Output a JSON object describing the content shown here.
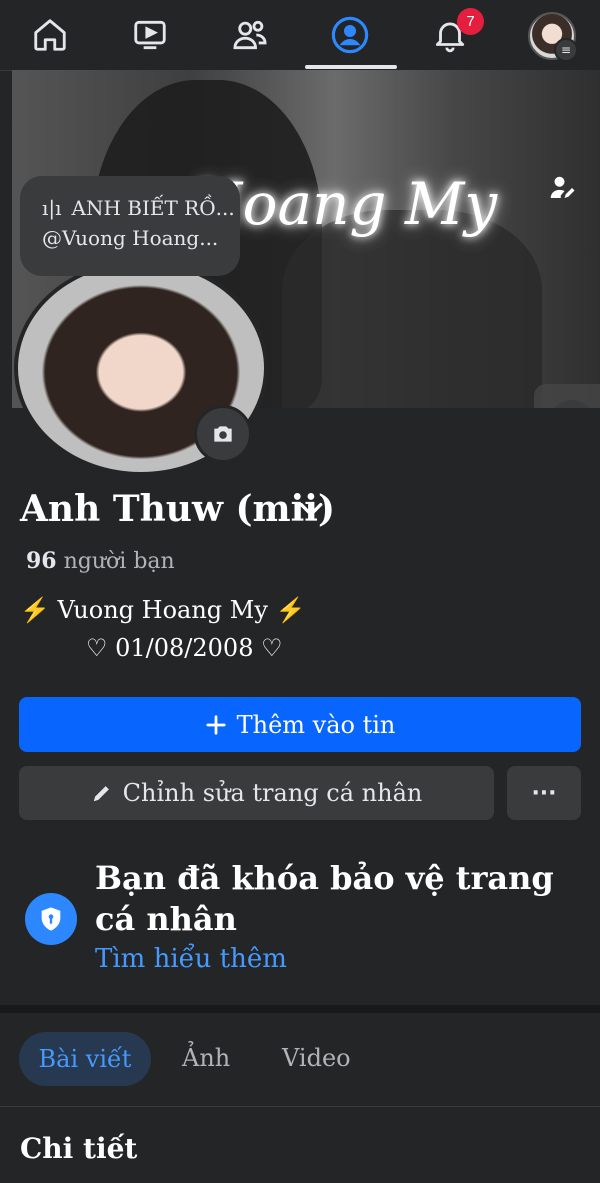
{
  "nav": {
    "items": [
      {
        "name": "home"
      },
      {
        "name": "video"
      },
      {
        "name": "friends"
      },
      {
        "name": "profile",
        "active": true
      },
      {
        "name": "notifications"
      },
      {
        "name": "menu-avatar"
      }
    ],
    "notification_badge": "7"
  },
  "cover": {
    "title_text": "Hoang My"
  },
  "note": {
    "line1": "ANH BIẾT RỒ...",
    "line2": "@Vuong Hoang..."
  },
  "profile": {
    "name": "Anh Thuw (mii)",
    "friends_count": "96",
    "friends_label": "người bạn",
    "bio_line1": "⚡ Vuong Hoang My ⚡",
    "bio_line2": "♡ 01/08/2008 ♡"
  },
  "actions": {
    "add_story_label": "Thêm vào tin",
    "edit_profile_label": "Chỉnh sửa trang cá nhân",
    "more_label": "···"
  },
  "lock_notice": {
    "title": "Bạn đã khóa bảo vệ trang cá nhân",
    "link": "Tìm hiểu thêm"
  },
  "tabs": [
    {
      "label": "Bài viết",
      "active": true
    },
    {
      "label": "Ảnh"
    },
    {
      "label": "Video"
    }
  ],
  "details_heading": "Chi tiết",
  "colors": {
    "background": "#242526",
    "primary": "#0866ff",
    "link": "#4599ff",
    "badge": "#e41e3f",
    "secondary_button": "#3a3b3c"
  }
}
